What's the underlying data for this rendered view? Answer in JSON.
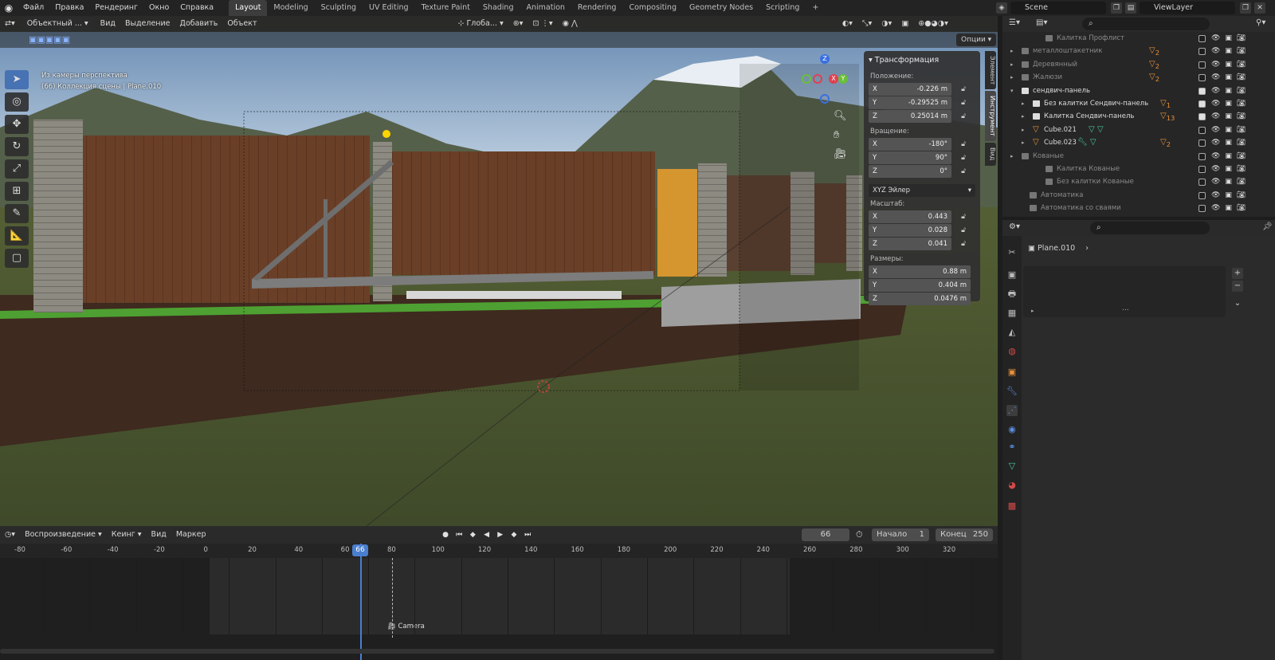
{
  "topbar": {
    "menu": [
      "Файл",
      "Правка",
      "Рендеринг",
      "Окно",
      "Справка"
    ],
    "workspaces": [
      "Layout",
      "Modeling",
      "Sculpting",
      "UV Editing",
      "Texture Paint",
      "Shading",
      "Animation",
      "Rendering",
      "Compositing",
      "Geometry Nodes",
      "Scripting"
    ],
    "active_workspace": "Layout",
    "add_tab": "+",
    "scene": "Scene",
    "view_layer": "ViewLayer"
  },
  "viewport": {
    "mode": "Объектный ...",
    "menus": [
      "Вид",
      "Выделение",
      "Добавить",
      "Объект"
    ],
    "orientation": "Глоба...",
    "options": "Опции",
    "info_line1": "Из камеры перспектива",
    "info_line2": "(66) Коллекция сцены | Plane.010",
    "gizmo": {
      "z": "Z",
      "x": "X",
      "y": "Y"
    },
    "tabs": [
      "Элемент",
      "Инструмент",
      "Вид"
    ]
  },
  "npanel": {
    "title": "Трансформация",
    "location_label": "Положение:",
    "location": [
      {
        "axis": "X",
        "value": "-0.226 m"
      },
      {
        "axis": "Y",
        "value": "-0.29525 m"
      },
      {
        "axis": "Z",
        "value": "0.25014 m"
      }
    ],
    "rotation_label": "Вращение:",
    "rotation": [
      {
        "axis": "X",
        "value": "-180°"
      },
      {
        "axis": "Y",
        "value": "90°"
      },
      {
        "axis": "Z",
        "value": "0°"
      }
    ],
    "euler": "XYZ Эйлер",
    "scale_label": "Масштаб:",
    "scale": [
      {
        "axis": "X",
        "value": "0.443"
      },
      {
        "axis": "Y",
        "value": "0.028"
      },
      {
        "axis": "Z",
        "value": "0.041"
      }
    ],
    "dimensions_label": "Размеры:",
    "dimensions": [
      {
        "axis": "X",
        "value": "0.88 m"
      },
      {
        "axis": "Y",
        "value": "0.404 m"
      },
      {
        "axis": "Z",
        "value": "0.0476 m"
      }
    ]
  },
  "timeline": {
    "menus": [
      "Воспроизведение",
      "Кеинг",
      "Вид",
      "Маркер"
    ],
    "current_frame": "66",
    "start_label": "Начало",
    "start": "1",
    "end_label": "Конец",
    "end": "250",
    "ticks": [
      "-80",
      "-60",
      "-40",
      "-20",
      "0",
      "20",
      "40",
      "60",
      "80",
      "100",
      "120",
      "140",
      "160",
      "180",
      "200",
      "220",
      "240",
      "260",
      "280",
      "300",
      "320"
    ],
    "marker": "Camera"
  },
  "outliner": {
    "rows": [
      {
        "name": "Калитка Профлист",
        "dim": true,
        "checked": false
      },
      {
        "name": "металлоштакетник",
        "dim": true,
        "checked": false,
        "badge": "2"
      },
      {
        "name": "Деревянный",
        "dim": true,
        "checked": false,
        "badge": "2"
      },
      {
        "name": "Жалюзи",
        "dim": true,
        "checked": false,
        "badge": "2"
      },
      {
        "name": "сендвич-панель",
        "dim": false,
        "checked": true
      },
      {
        "name": "Без калитки Сендвич-панель",
        "dim": false,
        "checked": true,
        "badge": "1"
      },
      {
        "name": "Калитка Сендвич-панель",
        "dim": false,
        "checked": true,
        "badge": "13"
      },
      {
        "name": "Cube.021",
        "dim": false,
        "checked": false
      },
      {
        "name": "Cube.023",
        "dim": false,
        "checked": false,
        "badge": "2"
      },
      {
        "name": "Кованые",
        "dim": true,
        "checked": false
      },
      {
        "name": "Калитка Кованые",
        "dim": true,
        "checked": false
      },
      {
        "name": "Без калитки Кованые",
        "dim": true,
        "checked": false
      },
      {
        "name": "Автоматика",
        "dim": true,
        "checked": false
      },
      {
        "name": "Автоматика со сваями",
        "dim": true,
        "checked": false
      }
    ]
  },
  "properties": {
    "object_name": "Plane.010",
    "expand": "...",
    "plus": "+",
    "minus": "−"
  }
}
